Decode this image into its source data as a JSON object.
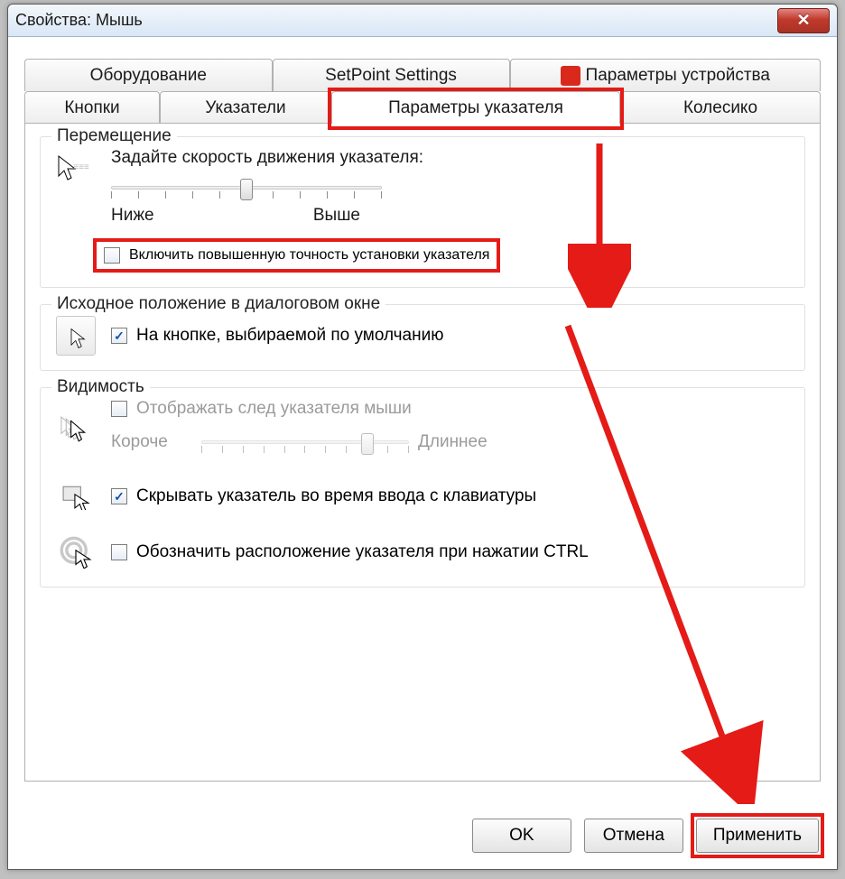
{
  "title": "Свойства: Мышь",
  "tabsRow1": [
    "Оборудование",
    "SetPoint Settings",
    "Параметры устройства"
  ],
  "tabsRow2": [
    "Кнопки",
    "Указатели",
    "Параметры указателя",
    "Колесико"
  ],
  "groups": {
    "move": {
      "legend": "Перемещение",
      "prompt": "Задайте скорость движения указателя:",
      "low": "Ниже",
      "high": "Выше",
      "precision": "Включить повышенную точность установки указателя"
    },
    "default": {
      "legend": "Исходное положение в диалоговом окне",
      "snap": "На кнопке, выбираемой по умолчанию"
    },
    "visibility": {
      "legend": "Видимость",
      "trail": "Отображать след указателя мыши",
      "short": "Короче",
      "long": "Длиннее",
      "hide": "Скрывать указатель во время ввода с клавиатуры",
      "ctrl": "Обозначить расположение указателя при нажатии CTRL"
    }
  },
  "buttons": {
    "ok": "OK",
    "cancel": "Отмена",
    "apply": "Применить"
  }
}
